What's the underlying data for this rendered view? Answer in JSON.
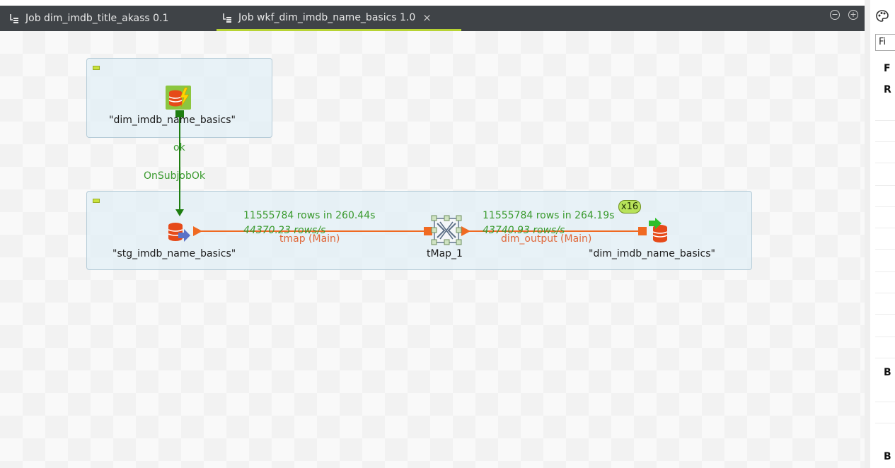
{
  "tabs": [
    {
      "label": "Job dim_imdb_title_akass 0.1",
      "active": false
    },
    {
      "label": "Job wkf_dim_imdb_name_basics 1.0",
      "active": true,
      "close_glyph": "×"
    }
  ],
  "tab_controls": {
    "minimize_glyph": "−",
    "maximize_glyph": "+"
  },
  "colors": {
    "accent": "#b7d334",
    "flow_orange": "#f06a22",
    "trigger_green": "#1e7d10",
    "stat_green": "#3a9a2e"
  },
  "canvas": {
    "subjob_1": {
      "component_label": "\"dim_imdb_name_basics\"",
      "component_icon": "tRunJob-icon"
    },
    "trigger": {
      "label_ok": "ok",
      "label_type": "OnSubjobOk"
    },
    "subjob_2": {
      "source": {
        "label": "\"stg_imdb_name_basics\"",
        "icon": "db-input-icon"
      },
      "tmap": {
        "label": "tMap_1",
        "icon": "tmap-icon"
      },
      "target": {
        "label": "\"dim_imdb_name_basics\"",
        "icon": "db-output-icon"
      },
      "flow_1": {
        "rows": "11555784 rows in 260.44s",
        "rate": "44370.23 rows/s",
        "name": "tmap (Main)"
      },
      "flow_2": {
        "rows": "11555784 rows in 264.19s",
        "rate": "43740.93 rows/s",
        "name": "dim_output (Main)"
      },
      "parallel_badge": "x16"
    }
  },
  "right_panel": {
    "top_icon": "palette-icon",
    "filter_placeholder": "Fi",
    "letters": [
      "F",
      "R",
      "B",
      "B"
    ]
  }
}
